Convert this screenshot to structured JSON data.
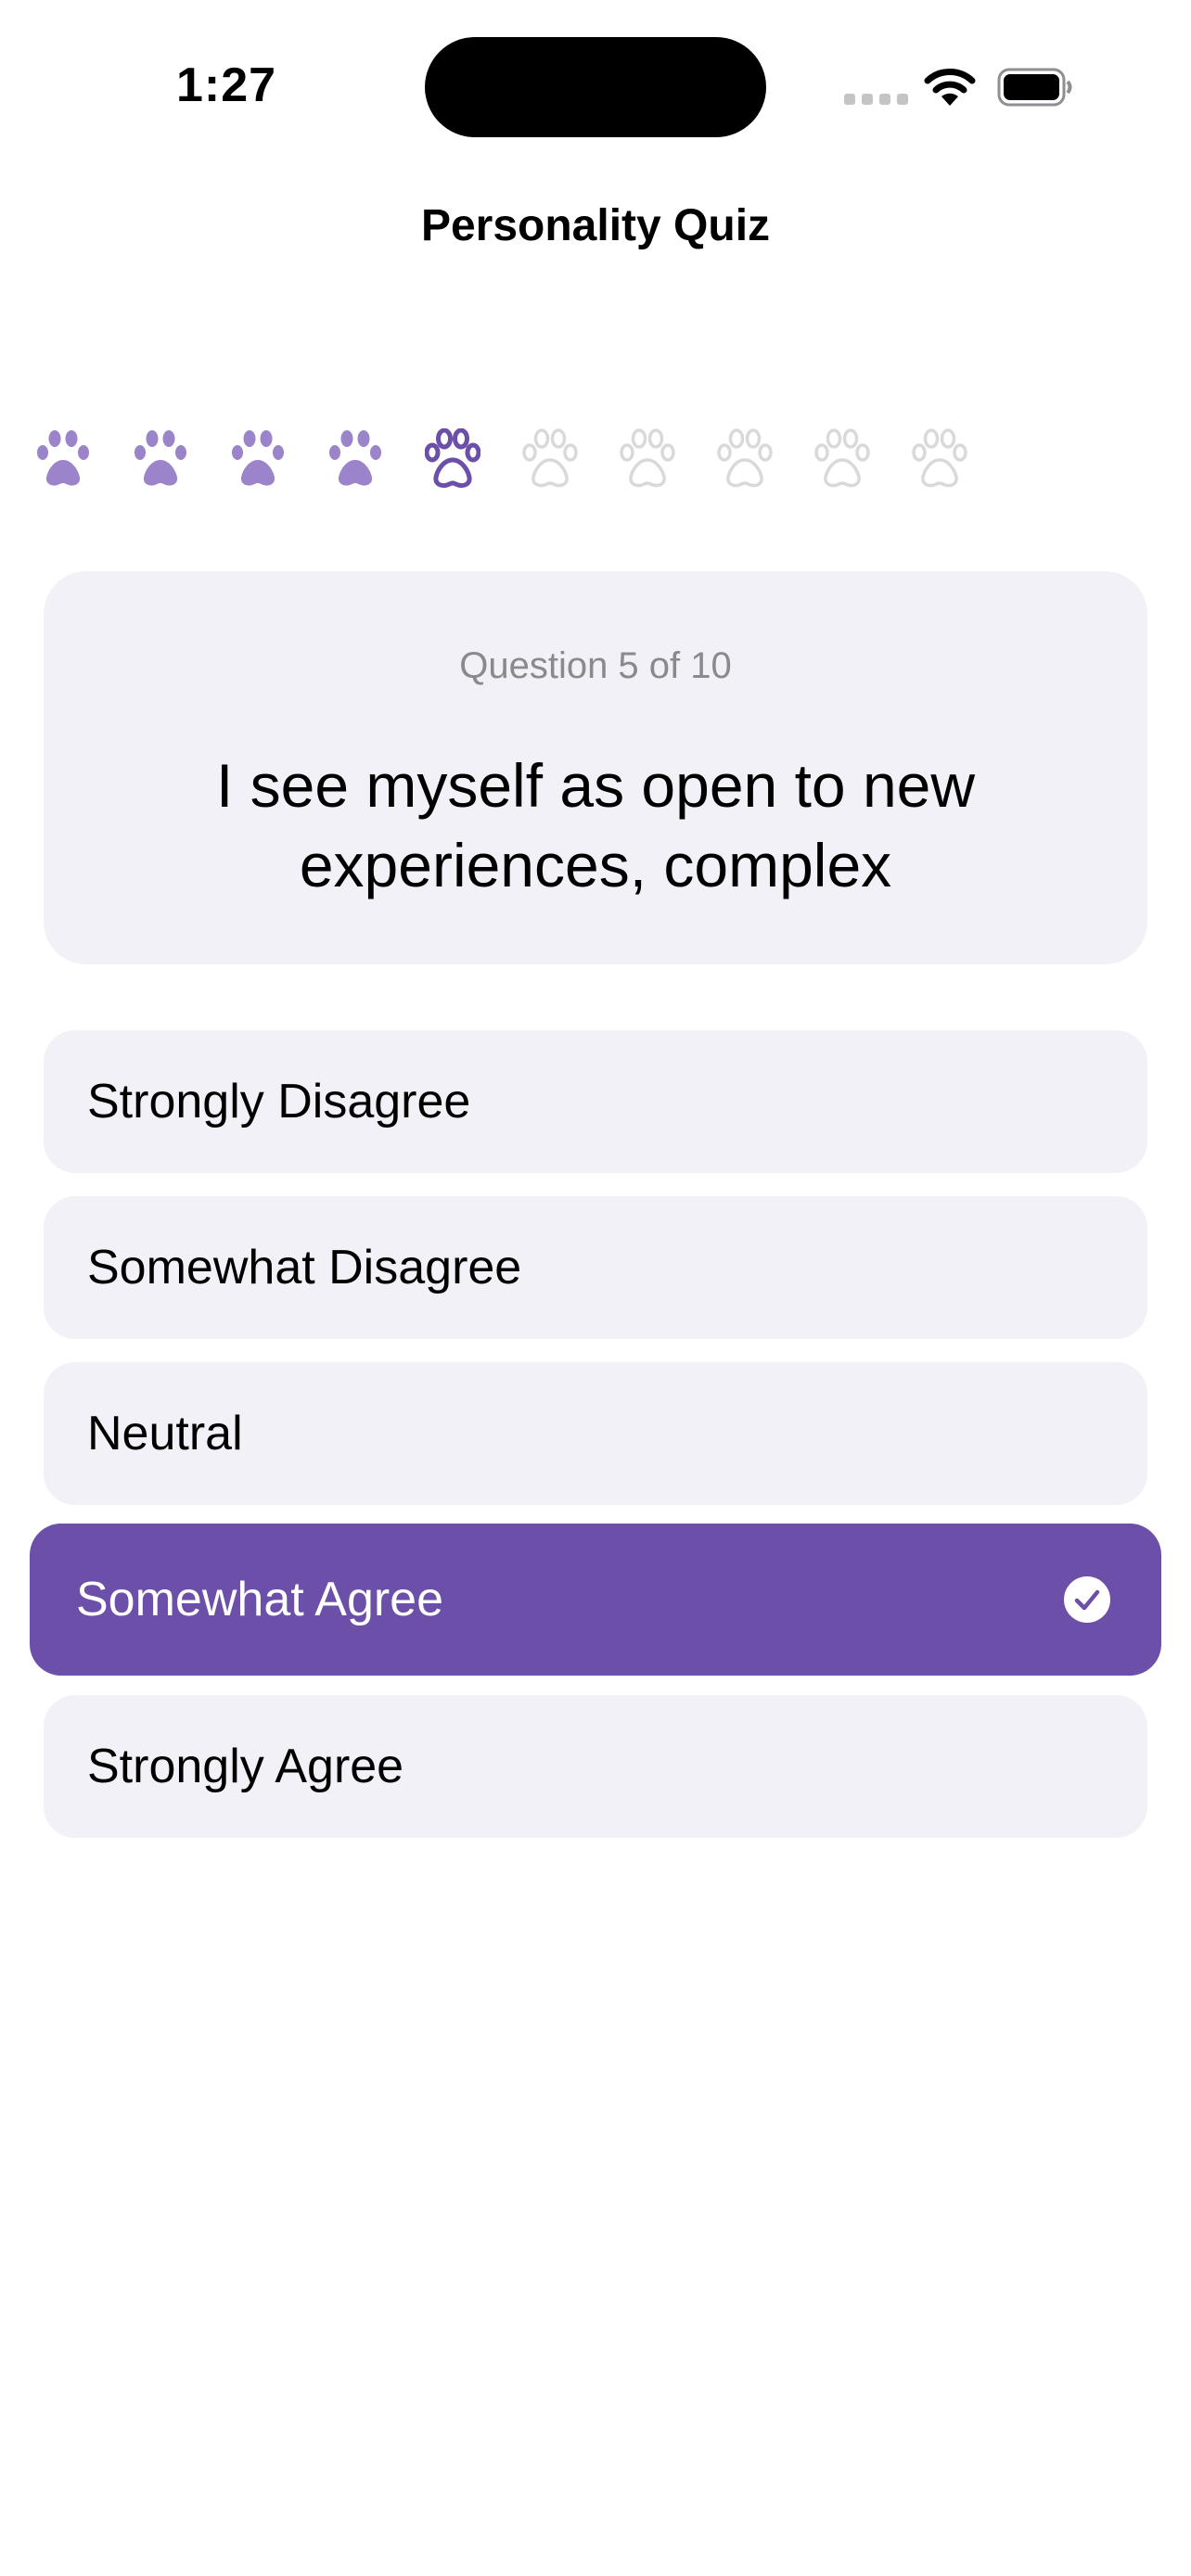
{
  "status_bar": {
    "time": "1:27",
    "icons": [
      "cellular-signal-icon",
      "wifi-icon",
      "battery-icon"
    ]
  },
  "nav": {
    "title": "Personality Quiz"
  },
  "progress": {
    "total": 10,
    "completed": 4,
    "current": 5,
    "icon": "paw-icon"
  },
  "question": {
    "counter": "Question 5 of 10",
    "text": "I see myself as open to new experiences, complex"
  },
  "answers": [
    {
      "label": "Strongly Disagree",
      "selected": false
    },
    {
      "label": "Somewhat Disagree",
      "selected": false
    },
    {
      "label": "Neutral",
      "selected": false
    },
    {
      "label": "Somewhat Agree",
      "selected": true
    },
    {
      "label": "Strongly Agree",
      "selected": false
    }
  ],
  "colors": {
    "accent": "#6b4fa8",
    "paw_done": "#9b84c9",
    "paw_current": "#6b4fa8",
    "paw_pending": "#d9d9dc",
    "card_bg": "#f2f1f7"
  }
}
